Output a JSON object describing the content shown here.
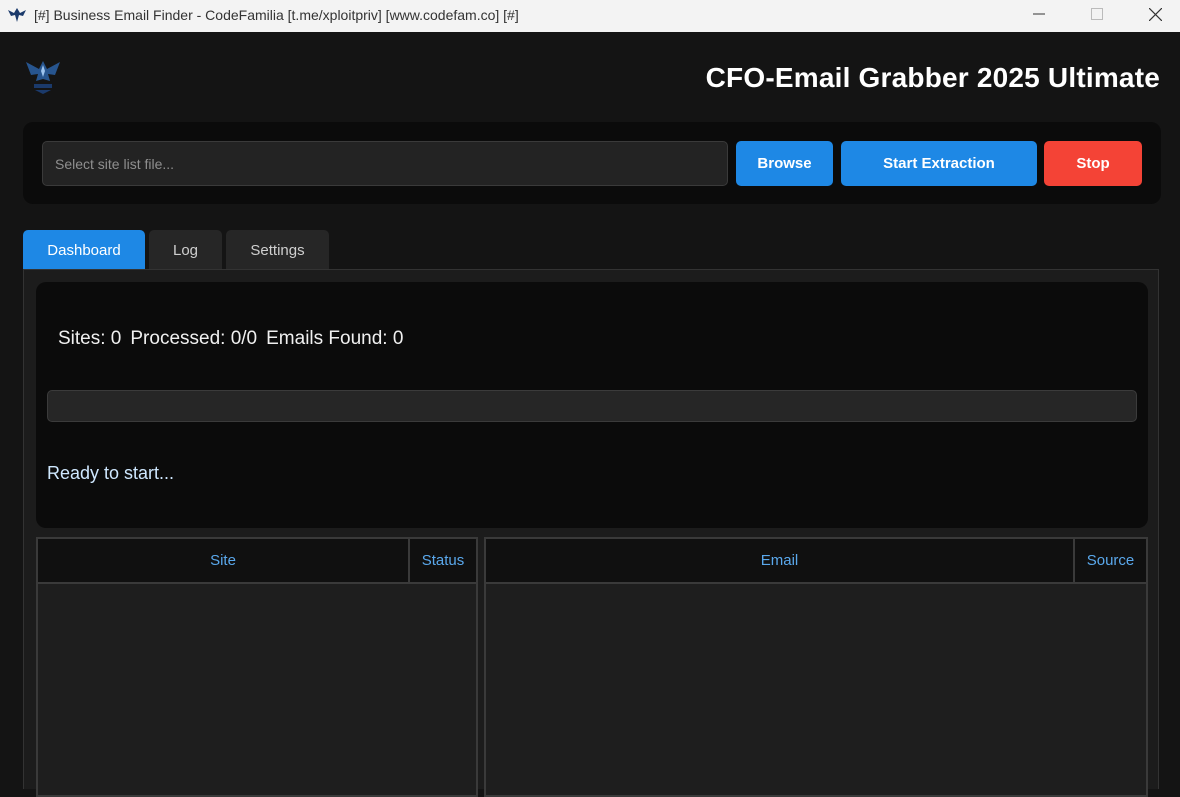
{
  "window": {
    "title": "[#] Business Email Finder - CodeFamilia [t.me/xploitpriv] [www.codefam.co] [#]"
  },
  "header": {
    "app_title": "CFO-Email Grabber 2025 Ultimate",
    "logo_icon": "eagle-logo-icon"
  },
  "toolbar": {
    "file_input": {
      "placeholder": "Select site list file...",
      "value": ""
    },
    "browse_label": "Browse",
    "start_label": "Start Extraction",
    "stop_label": "Stop"
  },
  "tabs": [
    {
      "label": "Dashboard",
      "active": true
    },
    {
      "label": "Log",
      "active": false
    },
    {
      "label": "Settings",
      "active": false
    }
  ],
  "stats": {
    "sites": "Sites: 0",
    "processed": "Processed: 0/0",
    "emails_found": "Emails Found: 0"
  },
  "progress": {
    "value": 0
  },
  "status_message": "Ready to start...",
  "sites_table": {
    "columns": [
      "Site",
      "Status"
    ],
    "rows": []
  },
  "emails_table": {
    "columns": [
      "Email",
      "Source"
    ],
    "rows": []
  },
  "colors": {
    "accent": "#1e88e5",
    "danger": "#f44336",
    "background": "#141414",
    "header_text": "#5aa8ec"
  }
}
